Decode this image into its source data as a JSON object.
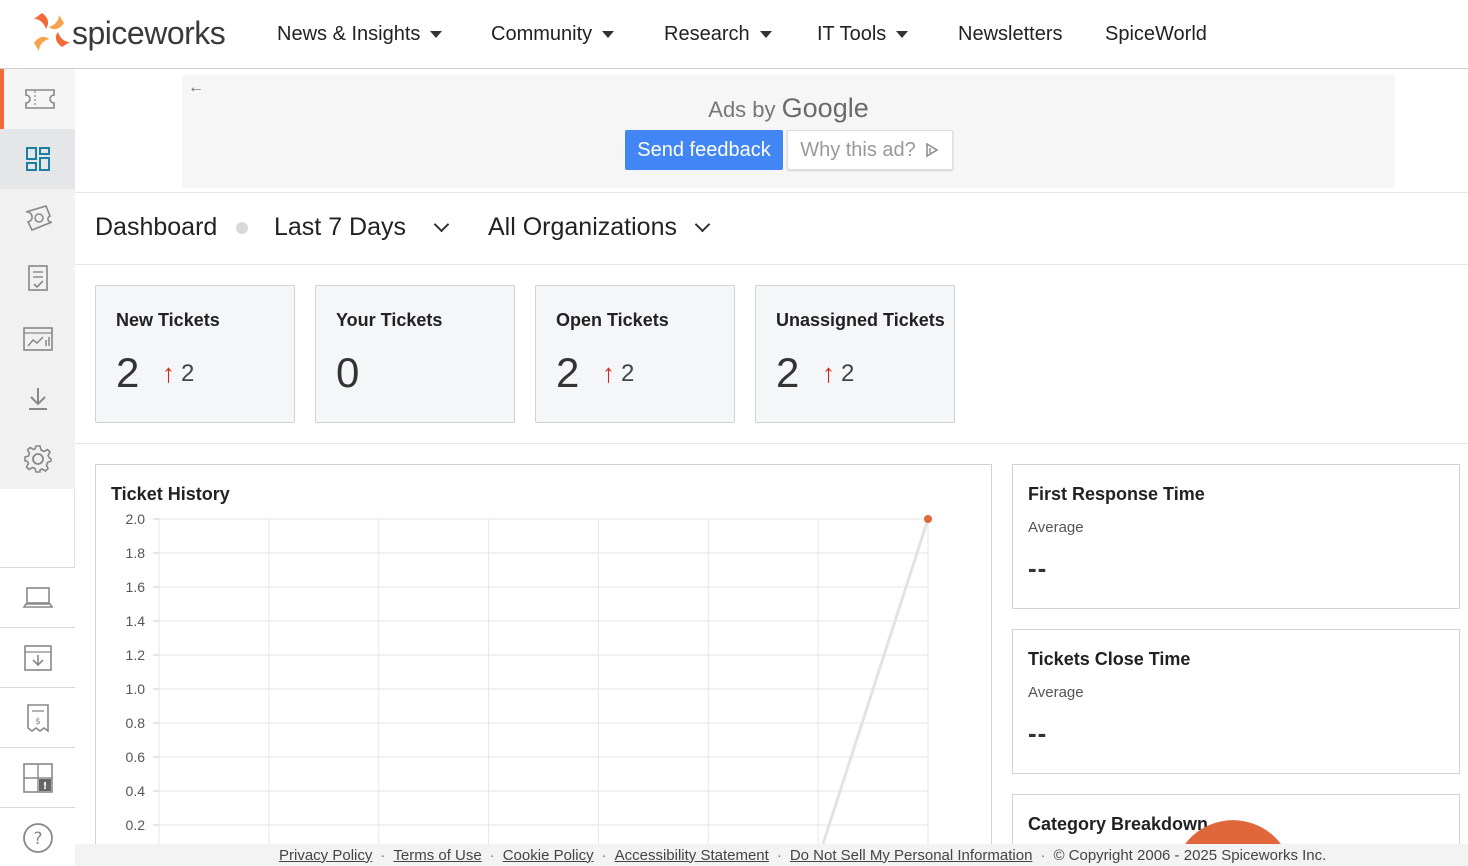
{
  "brand": {
    "name": "spiceworks",
    "accent": "#f26b36"
  },
  "nav": {
    "items": [
      {
        "label": "News & Insights",
        "dropdown": true
      },
      {
        "label": "Community",
        "dropdown": true
      },
      {
        "label": "Research",
        "dropdown": true
      },
      {
        "label": "IT Tools",
        "dropdown": true
      },
      {
        "label": "Newsletters",
        "dropdown": false
      },
      {
        "label": "SpiceWorld",
        "dropdown": false
      }
    ]
  },
  "sidebar": {
    "top_icons": [
      "ticket-icon",
      "dashboard-icon",
      "tickets-settings-icon",
      "checklist-icon",
      "reports-icon",
      "download-icon",
      "gear-icon"
    ],
    "bottom_icons": [
      "laptop-icon",
      "inbox-download-icon",
      "invoice-icon",
      "grid-alert-icon",
      "help-icon"
    ]
  },
  "ad": {
    "ads_by": "Ads by",
    "google": "Google",
    "send_feedback": "Send feedback",
    "why_this_ad": "Why this ad?"
  },
  "dashboard": {
    "title": "Dashboard",
    "period": "Last 7 Days",
    "organization": "All Organizations"
  },
  "stats": [
    {
      "label": "New Tickets",
      "value": "2",
      "delta": "2"
    },
    {
      "label": "Your Tickets",
      "value": "0",
      "delta": ""
    },
    {
      "label": "Open Tickets",
      "value": "2",
      "delta": "2"
    },
    {
      "label": "Unassigned Tickets",
      "value": "2",
      "delta": "2"
    }
  ],
  "ticket_history": {
    "title": "Ticket History"
  },
  "chart_data": {
    "type": "line",
    "title": "Ticket History",
    "y_ticks": [
      "2.0",
      "1.8",
      "1.6",
      "1.4",
      "1.2",
      "1.0",
      "0.8",
      "0.6",
      "0.4",
      "0.2"
    ],
    "ylim": [
      0,
      2.0
    ],
    "x_count": 8,
    "series": [
      {
        "values": [
          0,
          0,
          0,
          0,
          0,
          0,
          0,
          2
        ]
      }
    ],
    "grid": true,
    "colors": {
      "line": "#e3e3e3",
      "point": "#e0673a"
    }
  },
  "first_response": {
    "title": "First Response Time",
    "sub": "Average",
    "value": "--"
  },
  "close_time": {
    "title": "Tickets Close Time",
    "sub": "Average",
    "value": "--"
  },
  "category": {
    "title": "Category Breakdown"
  },
  "footer": {
    "links": [
      "Privacy Policy",
      "Terms of Use",
      "Cookie Policy",
      "Accessibility Statement",
      "Do Not Sell My Personal Information"
    ],
    "copyright": "© Copyright 2006 - 2025 Spiceworks Inc."
  }
}
